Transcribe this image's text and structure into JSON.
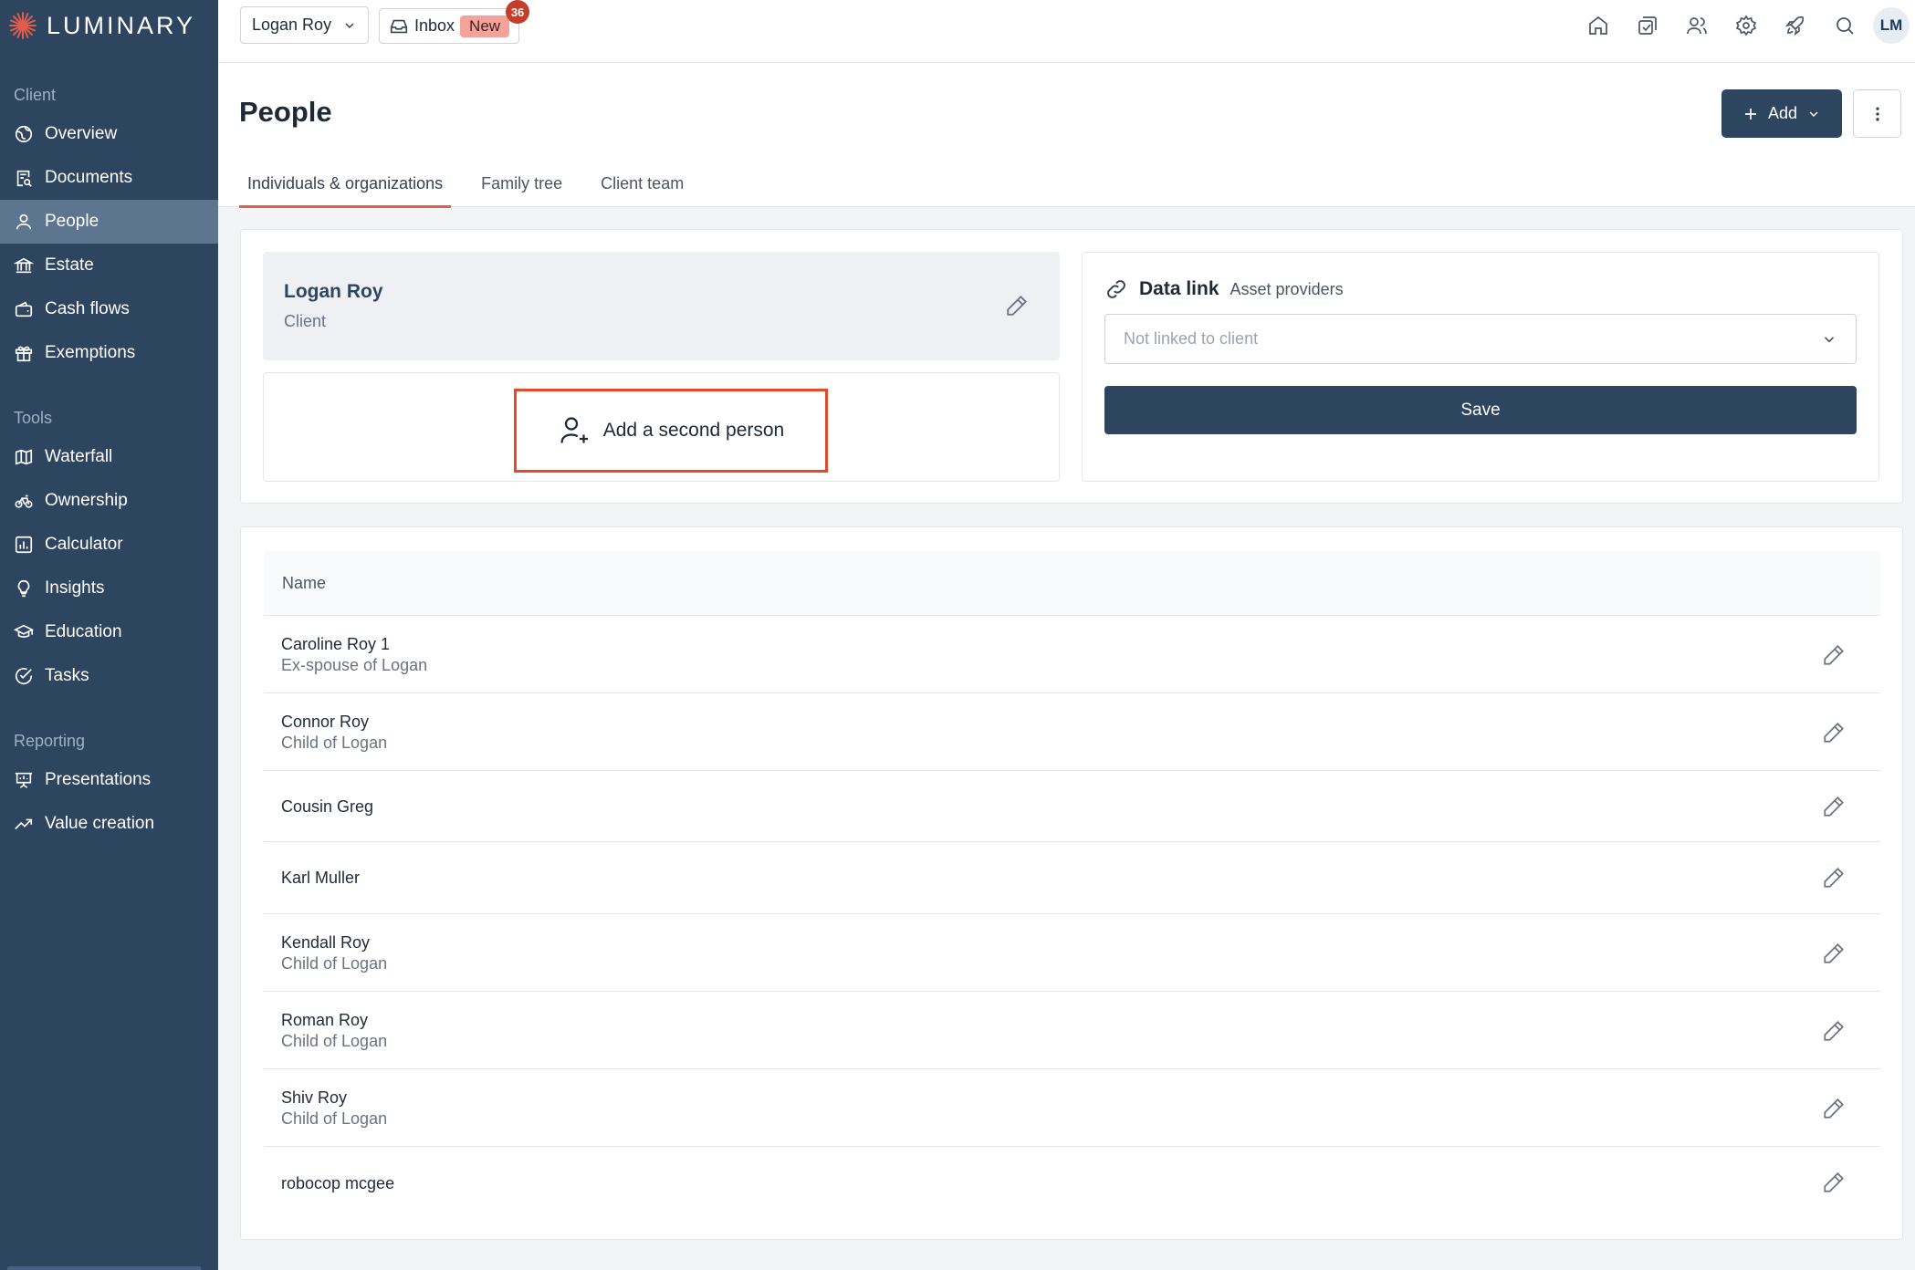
{
  "brand": {
    "name": "LUMINARY",
    "accent": "#e35d4a",
    "sidebar_bg": "#2e4560"
  },
  "topbar": {
    "client_name": "Logan Roy",
    "inbox_label": "Inbox",
    "inbox_new": "New",
    "inbox_count": "36",
    "avatar_initials": "LM",
    "icons": [
      "home-icon",
      "tasks-icon",
      "users-icon",
      "settings-icon",
      "rocket-icon",
      "search-icon"
    ]
  },
  "sidebar": {
    "sections": [
      {
        "label": "Client",
        "items": [
          "Overview",
          "Documents",
          "People",
          "Estate",
          "Cash flows",
          "Exemptions"
        ]
      },
      {
        "label": "Tools",
        "items": [
          "Waterfall",
          "Ownership",
          "Calculator",
          "Insights",
          "Education",
          "Tasks"
        ]
      },
      {
        "label": "Reporting",
        "items": [
          "Presentations",
          "Value creation"
        ]
      }
    ],
    "active_item": "People"
  },
  "header": {
    "title": "People",
    "add_label": "Add",
    "tabs": [
      "Individuals & organizations",
      "Family tree",
      "Client team"
    ],
    "active_tab": "Individuals & organizations"
  },
  "client_card": {
    "name": "Logan Roy",
    "role": "Client",
    "add_second_label": "Add a second person"
  },
  "data_link": {
    "title": "Data link",
    "subtitle": "Asset providers",
    "select_placeholder": "Not linked to client",
    "save_label": "Save"
  },
  "table": {
    "header_name": "Name",
    "rows": [
      {
        "name": "Caroline Roy 1",
        "relation": "Ex-spouse of Logan"
      },
      {
        "name": "Connor Roy",
        "relation": "Child of Logan"
      },
      {
        "name": "Cousin Greg",
        "relation": ""
      },
      {
        "name": "Karl Muller",
        "relation": ""
      },
      {
        "name": "Kendall Roy",
        "relation": "Child of Logan"
      },
      {
        "name": "Roman Roy",
        "relation": "Child of Logan"
      },
      {
        "name": "Shiv Roy",
        "relation": "Child of Logan"
      },
      {
        "name": "robocop mcgee",
        "relation": ""
      }
    ]
  }
}
